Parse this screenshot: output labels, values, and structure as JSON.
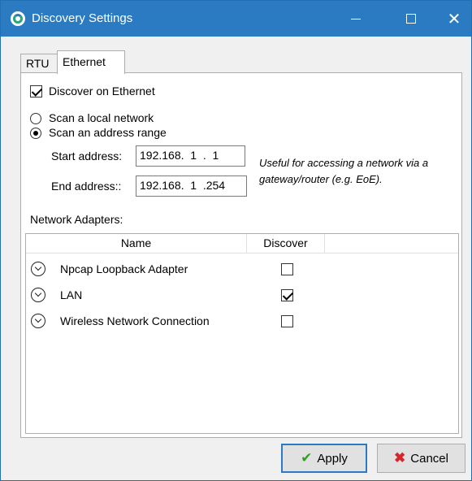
{
  "window": {
    "title": "Discovery Settings",
    "icon": "app-logo-icon",
    "controls": {
      "minimize": "minimize-icon",
      "maximize": "maximize-icon",
      "close": "✕"
    }
  },
  "tabs": [
    {
      "label": "RTU",
      "selected": false
    },
    {
      "label": "Ethernet",
      "selected": true
    }
  ],
  "ethernet": {
    "discover_label": "Discover on Ethernet",
    "discover_checked": true,
    "scan_local_label": "Scan a local network",
    "scan_range_label": "Scan an address range",
    "scan_mode": "range",
    "start_label": "Start address:",
    "start_value": "192.168.  1  .  1",
    "end_label": "End address::",
    "end_value": "192.168.  1  .254",
    "hint": "Useful for accessing a network via a gateway/router (e.g. EoE).",
    "adapters_label": "Network Adapters:",
    "columns": [
      "Name",
      "Discover"
    ],
    "adapters": [
      {
        "name": "Npcap Loopback Adapter",
        "discover": false
      },
      {
        "name": "LAN",
        "discover": true
      },
      {
        "name": "Wireless Network Connection",
        "discover": false
      }
    ]
  },
  "buttons": {
    "apply": "Apply",
    "cancel": "Cancel"
  },
  "colors": {
    "titlebar": "#2b7bc2",
    "apply_icon": "#3a9a2a",
    "cancel_icon": "#d9262c"
  }
}
